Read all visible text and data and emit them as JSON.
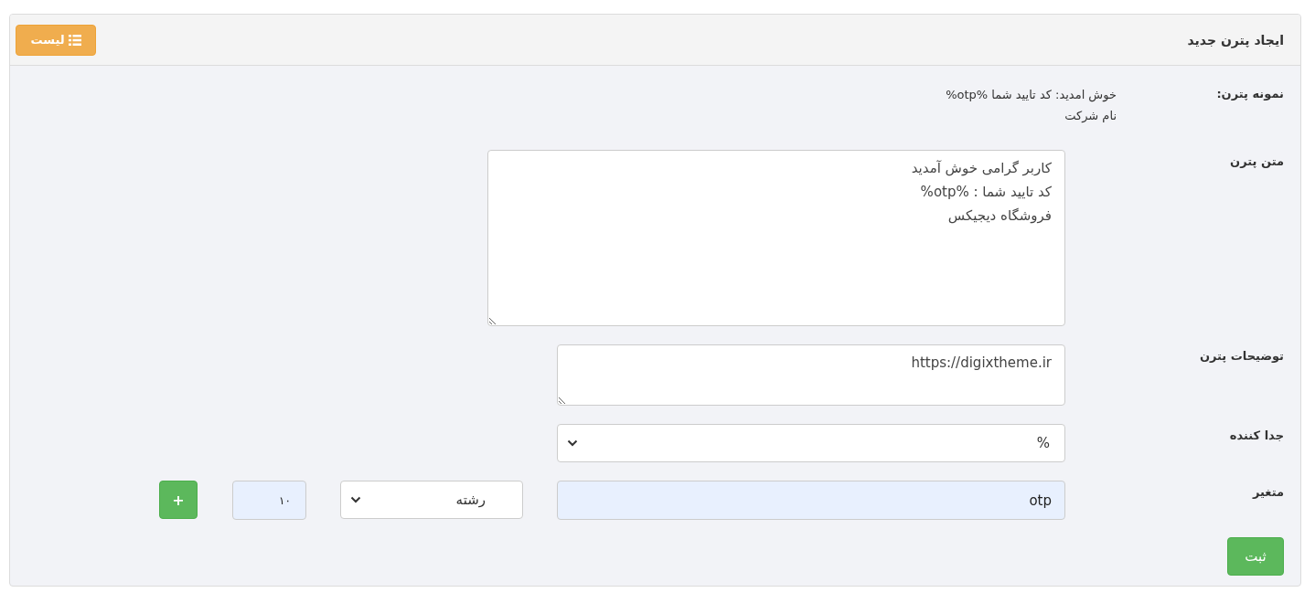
{
  "header": {
    "title": "ایجاد پترن جدید",
    "list_button": "لیست"
  },
  "sample": {
    "label": "نمونه پترن:",
    "lines": [
      "خوش امدید: کد تایید شما %otp%",
      "نام شرکت"
    ]
  },
  "fields": [
    {
      "kind": "editor",
      "label": "متن پترن",
      "value": "کاربر گرامی خوش آمدید\nکد تایید شما : %otp%\nفروشگاه دیجیکس"
    },
    {
      "kind": "textarea",
      "label": "توضیحات پترن",
      "value": "https://digixtheme.ir"
    },
    {
      "kind": "select",
      "label": "جدا کننده",
      "value": "%"
    },
    {
      "kind": "variable",
      "label": "متغیر",
      "name": "otp",
      "type": "رشته",
      "length": "۱۰",
      "add_button": "+"
    }
  ],
  "submit": "ثبت"
}
